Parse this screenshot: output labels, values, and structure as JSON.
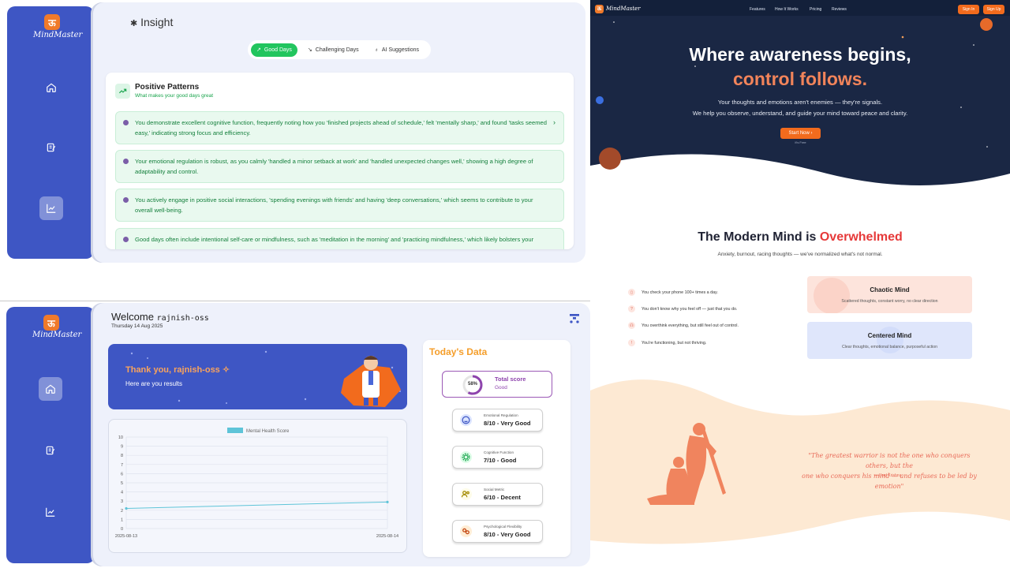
{
  "brand": {
    "name": "MindMaster",
    "logo_char": "ऊ"
  },
  "insight": {
    "title": "Insight",
    "tabs": [
      {
        "label": "Good Days",
        "active": true
      },
      {
        "label": "Challenging Days",
        "active": false
      },
      {
        "label": "AI Suggestions",
        "active": false
      }
    ],
    "positive": {
      "title": "Positive Patterns",
      "subtitle": "What makes your good days great",
      "items": [
        "You demonstrate excellent cognitive function, frequently noting how you 'finished projects ahead of schedule,' felt 'mentally sharp,' and found 'tasks seemed easy,' indicating strong focus and efficiency.",
        "Your emotional regulation is robust, as you calmly 'handled a minor setback at work' and 'handled unexpected changes well,' showing a high degree of adaptability and control.",
        "You actively engage in positive social interactions, 'spending evenings with friends' and having 'deep conversations,' which seems to contribute to your overall well-being.",
        "Good days often include intentional self-care or mindfulness, such as 'meditation in the morning' and 'practicing mindfulness,' which likely bolsters your"
      ]
    }
  },
  "dashboard": {
    "welcome_prefix": "Welcome",
    "username": "rajnish-oss",
    "date": "Thursday 14 Aug 2025",
    "thanks_title": "Thank you, rajnish-oss",
    "thanks_sub": "Here are you results",
    "today_title": "Today's Data",
    "total": {
      "percent": "58%",
      "percent_value": 0.58,
      "label": "Total score",
      "status": "Good"
    },
    "metrics": [
      {
        "label": "Emotional Regulation",
        "value": "8/10 - Very Good",
        "icon": "smile-icon",
        "color": "#dbe4ff"
      },
      {
        "label": "Cognitive Function",
        "value": "7/10 - Good",
        "icon": "gear-icon",
        "color": "#dcfce7"
      },
      {
        "label": "Social Metric",
        "value": "6/10 - Decent",
        "icon": "users-icon",
        "color": "#fefce8"
      },
      {
        "label": "Psychological Flexibility",
        "value": "8/10 - Very Good",
        "icon": "puzzle-icon",
        "color": "#ffedd5"
      }
    ]
  },
  "chart_data": {
    "type": "line",
    "title": "",
    "legend": [
      "Mental Health Score"
    ],
    "categories": [
      "2025-08-13",
      "2025-08-14"
    ],
    "series": [
      {
        "name": "Mental Health Score",
        "values": [
          2.2,
          2.9
        ]
      }
    ],
    "ylim": [
      0,
      10
    ],
    "yticks": [
      "0",
      "1",
      "2",
      "3",
      "4",
      "5",
      "6",
      "7",
      "8",
      "9",
      "10"
    ],
    "color": "#5ec4d8",
    "grid": true,
    "legend_position": "top"
  },
  "landing": {
    "nav": {
      "links": [
        "Features",
        "How It Works",
        "Pricing",
        "Reviews"
      ],
      "sign_in": "Sign In",
      "sign_up": "Sign Up"
    },
    "hero": {
      "line1": "Where awareness begins,",
      "line2": "control follows.",
      "p1": "Your thoughts and emotions aren't enemies — they're signals.",
      "p2": "We help you observe, understand, and guide your mind toward peace and clarity.",
      "cta": "Start Now",
      "cta_note": "It's Free"
    },
    "section": {
      "title_a": "The Modern Mind is ",
      "title_b": "Overwhelmed",
      "subtitle": "Anxiety, burnout, racing thoughts — we've normalized what's not normal.",
      "bullets": [
        "You check your phone 100+ times a day.",
        "You don't know why you feel off — just that you do.",
        "You overthink everything, but still feel out of control.",
        "You're functioning, but not thriving."
      ],
      "chaotic_title": "Chaotic Mind",
      "chaotic_sub": "Scattered thoughts, constant worry, no clear direction",
      "centered_title": "Centered Mind",
      "centered_sub": "Clear thoughts, emotional balance, purposeful action"
    },
    "quote": {
      "line1": "\"The greatest warrior is not the one who conquers others, but the",
      "line2": "one who conquers his mind — and refuses to be led by emotion\"",
      "author": "— Lord Krishna"
    }
  },
  "colors": {
    "primary": "#3e56c4",
    "accent": "#f26b1d",
    "success": "#22c55e",
    "navy": "#1a2744"
  }
}
